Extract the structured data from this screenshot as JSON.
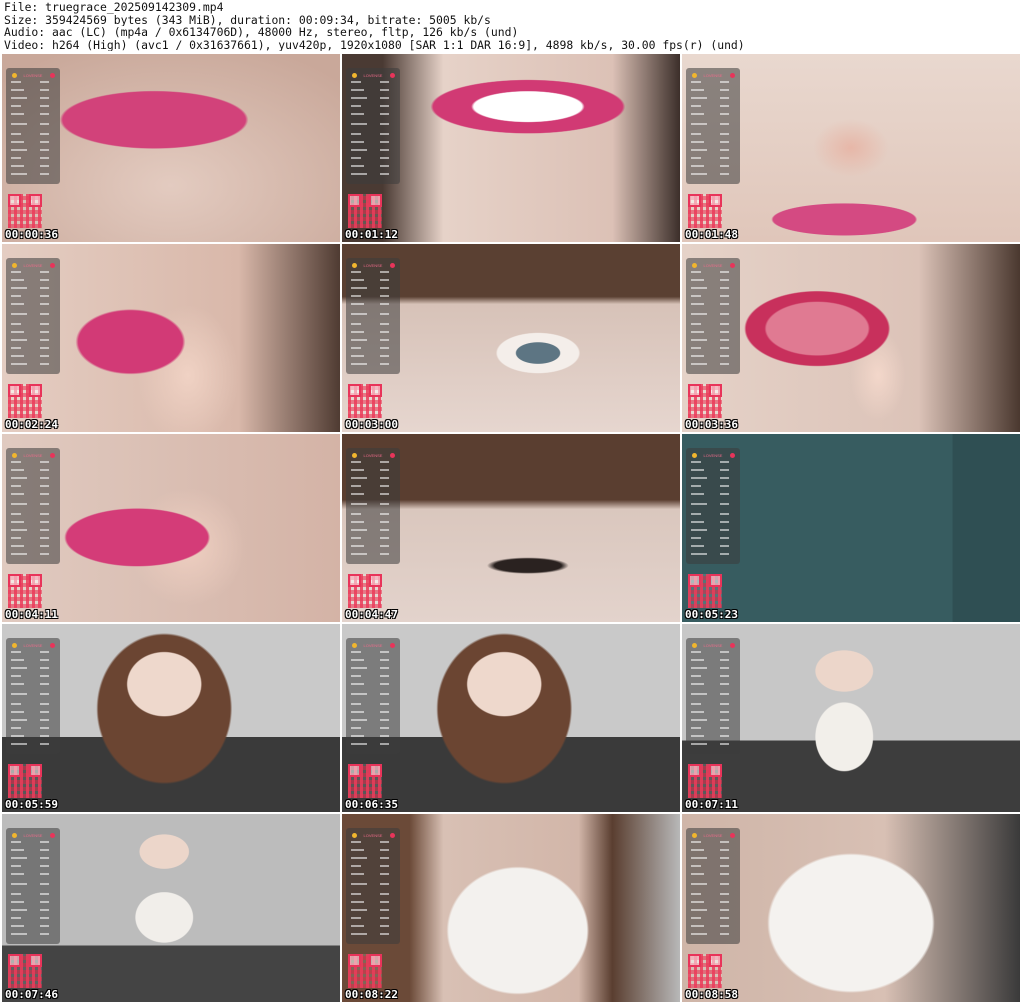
{
  "header": {
    "line1": "File: truegrace_202509142309.mp4",
    "line2": "Size: 359424569 bytes (343 MiB), duration: 00:09:34, bitrate: 5005 kb/s",
    "line3": "Audio: aac (LC) (mp4a / 0x6134706D), 48000 Hz, stereo, fltp, 126 kb/s (und)",
    "line4": "Video: h264 (High) (avc1 / 0x31637661), yuv420p, 1920x1080 [SAR 1:1 DAR 16:9], 4898 kb/s, 30.00 fps(r) (und)"
  },
  "thumbnails": [
    {
      "timestamp": "00:00:36",
      "scene": "lips"
    },
    {
      "timestamp": "00:01:12",
      "scene": "smile"
    },
    {
      "timestamp": "00:01:48",
      "scene": "nose"
    },
    {
      "timestamp": "00:02:24",
      "scene": "finger"
    },
    {
      "timestamp": "00:03:00",
      "scene": "eye"
    },
    {
      "timestamp": "00:03:36",
      "scene": "tongue"
    },
    {
      "timestamp": "00:04:11",
      "scene": "lips2"
    },
    {
      "timestamp": "00:04:47",
      "scene": "eye2"
    },
    {
      "timestamp": "00:05:23",
      "scene": "wall"
    },
    {
      "timestamp": "00:05:59",
      "scene": "girl"
    },
    {
      "timestamp": "00:06:35",
      "scene": "girl"
    },
    {
      "timestamp": "00:07:11",
      "scene": "girl2"
    },
    {
      "timestamp": "00:07:46",
      "scene": "girl3"
    },
    {
      "timestamp": "00:08:22",
      "scene": "top"
    },
    {
      "timestamp": "00:08:58",
      "scene": "top2"
    }
  ],
  "overlay": {
    "heading": "LOVENSE",
    "accent": "#e8345a"
  }
}
